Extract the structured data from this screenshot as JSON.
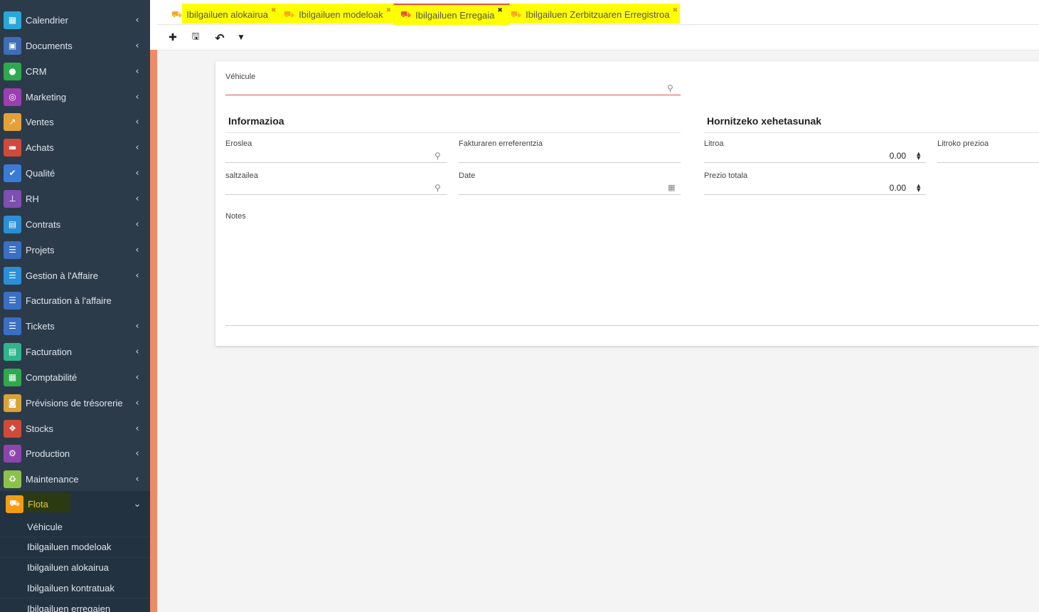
{
  "sidebar": {
    "items": [
      {
        "label": "Calendrier",
        "color": "#28a8d8",
        "icon": "calendar-icon",
        "glyph": "▦"
      },
      {
        "label": "Documents",
        "color": "#3d6db5",
        "icon": "documents-icon",
        "glyph": "▣"
      },
      {
        "label": "CRM",
        "color": "#2fa84f",
        "icon": "user-icon",
        "glyph": "●"
      },
      {
        "label": "Marketing",
        "color": "#9b3fb0",
        "icon": "target-icon",
        "glyph": "◎"
      },
      {
        "label": "Ventes",
        "color": "#e4a13a",
        "icon": "chart-line-icon",
        "glyph": "↗"
      },
      {
        "label": "Achats",
        "color": "#d04a3c",
        "icon": "cart-icon",
        "glyph": "▬"
      },
      {
        "label": "Qualité",
        "color": "#3a7bd5",
        "icon": "check-icon",
        "glyph": "✔"
      },
      {
        "label": "RH",
        "color": "#7d4fb0",
        "icon": "org-chart-icon",
        "glyph": "⊥"
      },
      {
        "label": "Contrats",
        "color": "#2a8fd8",
        "icon": "briefcase-icon",
        "glyph": "▤"
      },
      {
        "label": "Projets",
        "color": "#3a6fc4",
        "icon": "tasks-icon",
        "glyph": "☰"
      },
      {
        "label": "Gestion à l'Affaire",
        "color": "#2a8fd8",
        "icon": "list-icon",
        "glyph": "☰"
      },
      {
        "label": "Facturation à l'affaire",
        "color": "#3a6fc4",
        "icon": "list-icon",
        "glyph": "☰",
        "no_chevron": true
      },
      {
        "label": "Tickets",
        "color": "#3a6fc4",
        "icon": "tickets-icon",
        "glyph": "☰"
      },
      {
        "label": "Facturation",
        "color": "#2fb58a",
        "icon": "invoice-icon",
        "glyph": "▤"
      },
      {
        "label": "Comptabilité",
        "color": "#2fa84f",
        "icon": "calculator-icon",
        "glyph": "▦"
      },
      {
        "label": "Prévisions de trésorerie",
        "color": "#d9a33a",
        "icon": "money-icon",
        "glyph": "◙"
      },
      {
        "label": "Stocks",
        "color": "#d04a3c",
        "icon": "cubes-icon",
        "glyph": "❖"
      },
      {
        "label": "Production",
        "color": "#8e44ad",
        "icon": "cogs-icon",
        "glyph": "⚙"
      },
      {
        "label": "Maintenance",
        "color": "#8bc34a",
        "icon": "recycle-icon",
        "glyph": "♻"
      }
    ],
    "active": {
      "label": "Flota",
      "color": "#f39c12",
      "icon": "car-icon",
      "glyph": "⛟"
    },
    "sub_items": [
      "Véhicule",
      "Ibilgailuen modeloak",
      "Ibilgailuen alokairua",
      "Ibilgailuen kontratuak",
      "Ibilgailuen erregaien"
    ]
  },
  "tabs": [
    {
      "label": "Ibilgailuen alokairua"
    },
    {
      "label": "Ibilgailuen modeloak"
    },
    {
      "label": "Ibilgailuen Erregaia"
    },
    {
      "label": "Ibilgailuen Zerbitzuaren Erregistroa"
    }
  ],
  "toolbar": {
    "buttons": [
      "add-icon",
      "save-icon",
      "undo-icon",
      "dropdown-caret-icon"
    ]
  },
  "form": {
    "vehicle_label": "Véhicule",
    "left_section_title": "Informazioa",
    "right_section_title": "Hornitzeko xehetasunak",
    "buyer_label": "Eroslea",
    "invoice_ref_label": "Fakturaren erreferentzia",
    "seller_label": "saltzailea",
    "date_label": "Date",
    "liters_label": "Litroa",
    "liters_value": "0.00",
    "price_per_liter_label": "Litroko prezioa",
    "total_price_label": "Prezio totala",
    "total_price_value": "0.00",
    "notes_label": "Notes"
  }
}
